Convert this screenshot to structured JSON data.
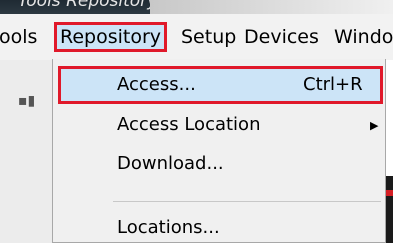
{
  "title": {
    "text": "Tools  Repository  Access"
  },
  "menubar": {
    "items": [
      {
        "label": "ools"
      },
      {
        "label": "Repository"
      },
      {
        "label": "Setup"
      },
      {
        "label": "Devices"
      },
      {
        "label": "Windo"
      }
    ]
  },
  "dropdown": {
    "items": [
      {
        "label": "Access...",
        "shortcut": "Ctrl+R"
      },
      {
        "label": "Access Location",
        "arrow": "▶"
      },
      {
        "label": "Download..."
      },
      {
        "label": "Locations..."
      }
    ]
  },
  "colors": {
    "highlight_border": "#e0192a",
    "highlight_fill": "#cce4f7",
    "menu_bg": "#f0f0f0"
  }
}
